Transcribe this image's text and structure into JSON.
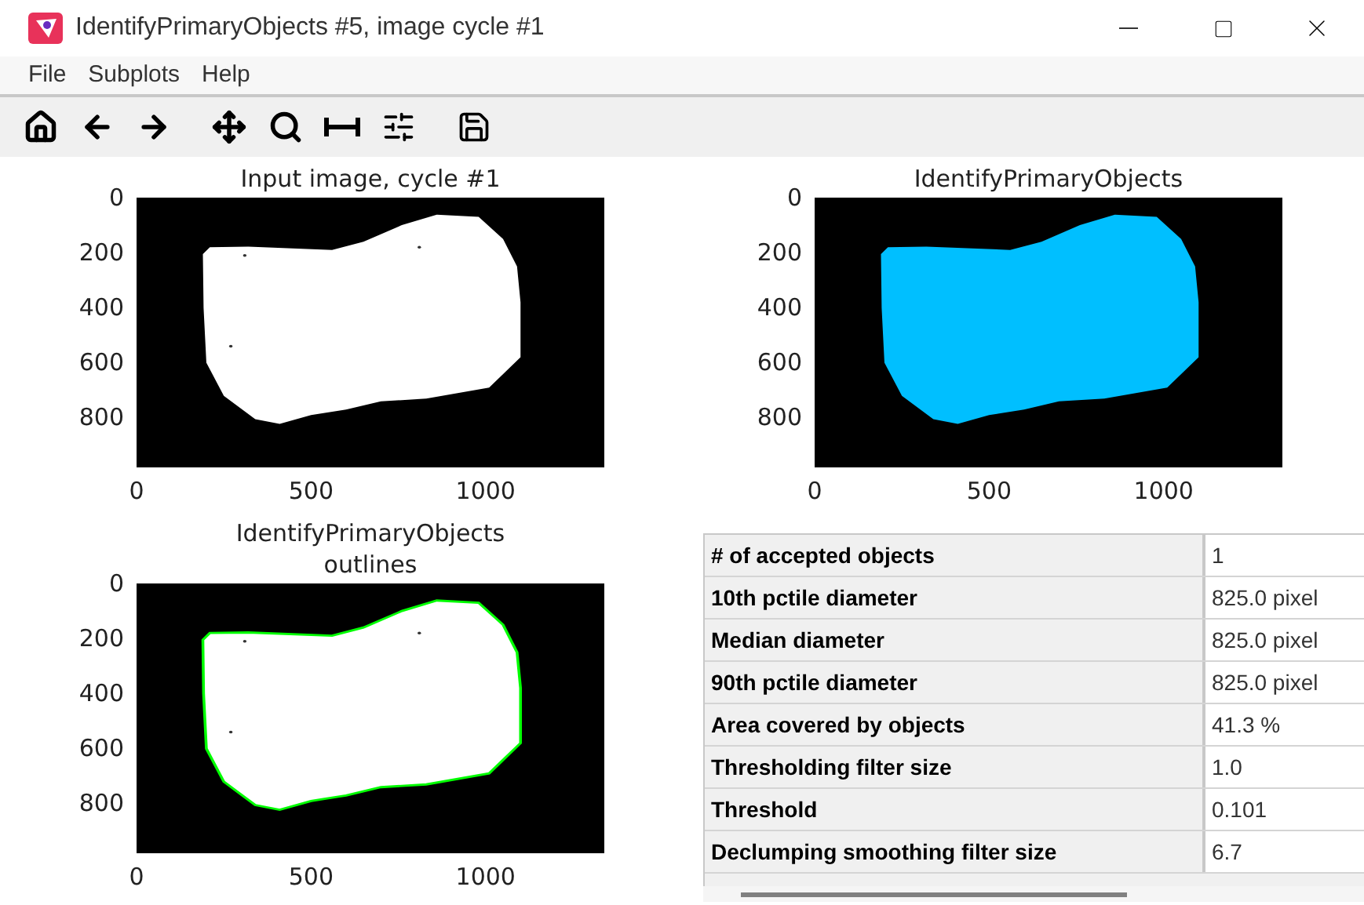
{
  "window": {
    "title": "IdentifyPrimaryObjects #5, image cycle #1"
  },
  "menu": [
    "File",
    "Subplots",
    "Help"
  ],
  "toolbar": [
    {
      "kind": "home"
    },
    {
      "kind": "back"
    },
    {
      "kind": "forward"
    },
    {
      "kind": "pan"
    },
    {
      "kind": "zoom"
    },
    {
      "kind": "subplots"
    },
    {
      "kind": "configure"
    },
    {
      "kind": "save"
    }
  ],
  "plots": [
    {
      "title": [
        "Input image, cycle #1"
      ],
      "kind": "input",
      "x_tick_labels": [
        "0",
        "500",
        "1000"
      ],
      "y_tick_labels": [
        "0",
        "200",
        "400",
        "600",
        "800"
      ]
    },
    {
      "title": [
        "IdentifyPrimaryObjects"
      ],
      "kind": "objects",
      "x_tick_labels": [
        "0",
        "500",
        "1000"
      ],
      "y_tick_labels": [
        "0",
        "200",
        "400",
        "600",
        "800"
      ]
    },
    {
      "title": [
        "IdentifyPrimaryObjects",
        "outlines"
      ],
      "kind": "outlines",
      "x_tick_labels": [
        "0",
        "500",
        "1000"
      ],
      "y_tick_labels": [
        "0",
        "200",
        "400",
        "600",
        "800"
      ]
    }
  ],
  "table": {
    "rows": [
      {
        "label": "# of accepted objects",
        "value": "1"
      },
      {
        "label": "10th pctile diameter",
        "value": "825.0 pixel"
      },
      {
        "label": "Median diameter",
        "value": "825.0 pixel"
      },
      {
        "label": "90th pctile diameter",
        "value": "825.0 pixel"
      },
      {
        "label": "Area covered by objects",
        "value": "41.3 %"
      },
      {
        "label": "Thresholding filter size",
        "value": "1.0"
      },
      {
        "label": "Threshold",
        "value": "0.101"
      },
      {
        "label": "Declumping smoothing filter size",
        "value": "6.7"
      }
    ]
  }
}
